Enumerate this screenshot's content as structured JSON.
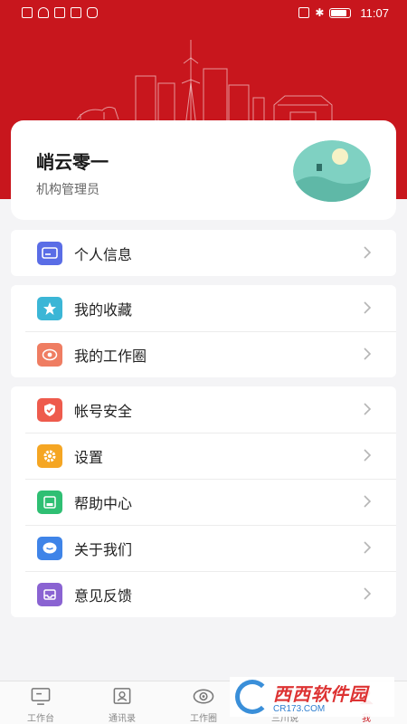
{
  "status_bar": {
    "time": "11:07"
  },
  "profile": {
    "name": "峭云零一",
    "role": "机构管理员"
  },
  "menu_groups": [
    {
      "items": [
        {
          "label": "个人信息",
          "icon": "id-card-icon",
          "color": "#5a6de6"
        }
      ]
    },
    {
      "items": [
        {
          "label": "我的收藏",
          "icon": "star-icon",
          "color": "#3bb6d6"
        },
        {
          "label": "我的工作圈",
          "icon": "eye-icon",
          "color": "#ef7d62"
        }
      ]
    },
    {
      "items": [
        {
          "label": "帐号安全",
          "icon": "shield-icon",
          "color": "#ee5b4d"
        },
        {
          "label": "设置",
          "icon": "gear-icon",
          "color": "#f5a623"
        },
        {
          "label": "帮助中心",
          "icon": "help-book-icon",
          "color": "#2fbf73"
        },
        {
          "label": "关于我们",
          "icon": "chat-bubble-icon",
          "color": "#3f84e8"
        },
        {
          "label": "意见反馈",
          "icon": "inbox-icon",
          "color": "#8a63d2"
        }
      ]
    }
  ],
  "tabbar": {
    "tabs": [
      {
        "label": "工作台",
        "icon": "monitor-icon"
      },
      {
        "label": "通讯录",
        "icon": "contacts-icon"
      },
      {
        "label": "工作圈",
        "icon": "eye-icon"
      },
      {
        "label": "三川说",
        "icon": "speech-icon"
      },
      {
        "label": "我",
        "icon": "user-icon",
        "active": true
      }
    ]
  },
  "watermark": {
    "title": "西西软件园",
    "url": "CR173.COM"
  },
  "colors": {
    "brand_red": "#c8161d",
    "background": "#f4f4f6"
  }
}
